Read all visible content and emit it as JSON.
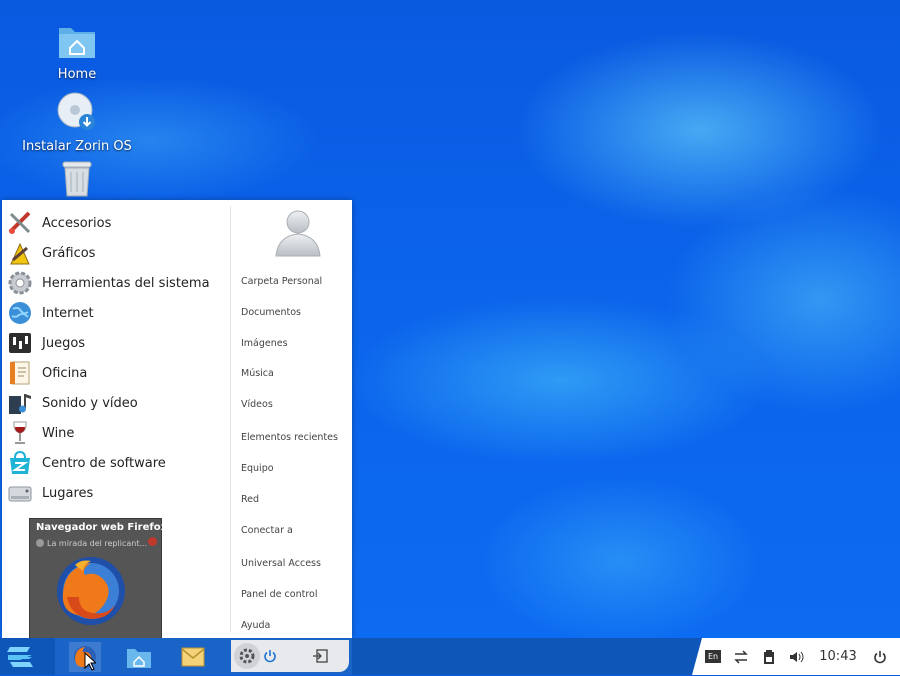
{
  "desktop": {
    "icons": [
      {
        "label": "Home",
        "icon": "home-folder-icon"
      },
      {
        "label": "Instalar Zorin OS",
        "icon": "install-disc-icon"
      },
      {
        "label": "",
        "icon": "trash-icon"
      }
    ]
  },
  "start_menu": {
    "categories": [
      {
        "label": "Accesorios",
        "icon": "accessories-icon"
      },
      {
        "label": "Gráficos",
        "icon": "graphics-icon"
      },
      {
        "label": "Herramientas del sistema",
        "icon": "system-tools-icon"
      },
      {
        "label": "Internet",
        "icon": "internet-globe-icon"
      },
      {
        "label": "Juegos",
        "icon": "games-icon"
      },
      {
        "label": "Oficina",
        "icon": "office-icon"
      },
      {
        "label": "Sonido y vídeo",
        "icon": "sound-video-icon"
      },
      {
        "label": "Wine",
        "icon": "wine-icon"
      },
      {
        "label": "Centro de software",
        "icon": "software-center-icon"
      },
      {
        "label": "Lugares",
        "icon": "places-drive-icon"
      }
    ],
    "user_avatar_icon": "user-avatar-icon",
    "places": [
      "Carpeta Personal",
      "Documentos",
      "Imágenes",
      "Música",
      "Vídeos",
      "Elementos recientes",
      "Equipo",
      "Red",
      "Conectar a",
      "Universal Access",
      "Panel de control",
      "Ayuda"
    ]
  },
  "tooltip": {
    "title": "Navegador web Firefox",
    "subtitle": "La mirada del replicant..."
  },
  "taskbar": {
    "start_icon": "zorin-logo-icon",
    "apps": [
      "firefox-icon",
      "files-home-icon",
      "mail-icon"
    ],
    "tray": {
      "keyboard_layout": "En",
      "clock": "10:43"
    }
  },
  "colors": {
    "taskbar": "#0e56b7",
    "desktop": "#0b63ea",
    "accent_light": "#5ad6ff"
  }
}
